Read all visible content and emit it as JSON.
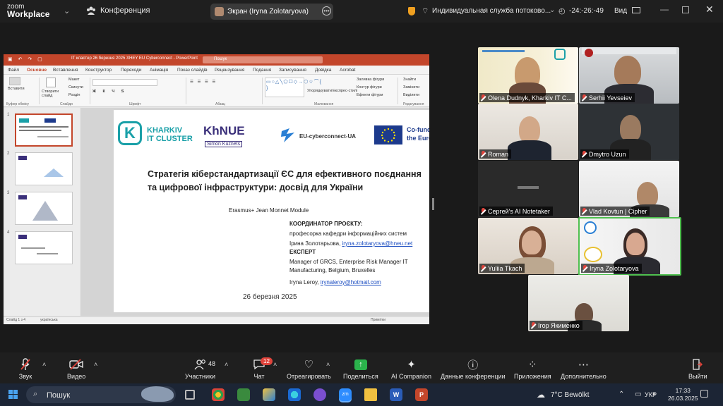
{
  "topbar": {
    "logo_line1": "zoom",
    "logo_line2": "Workplace",
    "conference": "Конференция",
    "screen_share_label": "Экран (Iryna Zolotaryova)",
    "service": "Индивидуальная служба потоково...",
    "timer": "-24:-26:-49",
    "view": "Вид"
  },
  "ppt": {
    "title": "IT кластер 26 березня 2025 XHEY EU Cyberconnect - PowerPoint",
    "search": "Пошук",
    "menu": [
      "Файл",
      "Основне",
      "Вставлення",
      "Конструктор",
      "Переходи",
      "Анімація",
      "Показ слайдів",
      "Рецензування",
      "Подання",
      "Записування",
      "Довідка",
      "Acrobat"
    ],
    "active_menu": "Основне",
    "ribbon": {
      "paste": "Вставити",
      "clipboard": "Буфер обміну",
      "new_slide": "Створити слайд",
      "layout": "Макет",
      "reset": "Скинути",
      "section": "Розділ",
      "slides": "Слайди",
      "font": "Шрифт",
      "paragraph": "Абзац",
      "arrange": "Упорядкувати",
      "quick_styles": "Експрес-стилі",
      "shape_fill": "Заливка фігури",
      "shape_outline": "Контур фігури",
      "shape_effects": "Ефекти фігури",
      "drawing": "Малювання",
      "find": "Знайти",
      "replace": "Замінити",
      "select": "Виділити",
      "editing": "Редагування"
    },
    "status": "Слайд 1 з 4",
    "language": "українська",
    "notes": "Примітки",
    "thumb_numbers": [
      "1",
      "2",
      "3",
      "4"
    ]
  },
  "slide": {
    "logo1_line1": "KHARKIV",
    "logo1_line2": "IT CLUSTER",
    "logo2": "KhNUE",
    "logo2_sub": "Simon Kuznets",
    "logo3": "EU-cyberconnect-UA",
    "logo4_line1": "Co-funded by",
    "logo4_line2": "the European Union",
    "title": "Стратегія кіберстандартизації ЄС для ефективного поєднання та цифрової інфраструктури: досвід для України",
    "module": "Erasmus+ Jean Monnet Module",
    "coordinator_heading": "КООРДИНАТОР ПРОЄКТУ:",
    "coordinator_role": "професорка кафедри інформаційних систем",
    "coordinator_name": "Ірина Золотарьова,",
    "coordinator_email": "iryna.zolotaryova@hneu.net",
    "expert_heading": "ЕКСПЕРТ",
    "expert_role1": "Manager of GRCS, Enterprise Risk Manager IT",
    "expert_role2": "Manufacturing, Belgium, Bruxelles",
    "expert_name": "Iryna Leroy,",
    "expert_email": "irynaleroy@hotmail.com",
    "date": "26 березня 2025"
  },
  "participants": [
    {
      "name": "Olena Dudnyk, Kharkiv IT C..."
    },
    {
      "name": "Serhii Yevseiev"
    },
    {
      "name": "Roman"
    },
    {
      "name": "Dmytro Uzun"
    },
    {
      "name": "Сергей's AI Notetaker"
    },
    {
      "name": "Vlad Kovtun | Cipher"
    },
    {
      "name": "Yuliia Tkach"
    },
    {
      "name": "Iryna Zolotaryova"
    },
    {
      "name": "Ігор Якименко"
    }
  ],
  "toolbar": {
    "audio": "Звук",
    "video": "Видео",
    "participants": "Участники",
    "participants_count": "48",
    "chat": "Чат",
    "chat_badge": "12",
    "react": "Отреагировать",
    "share": "Поделиться",
    "ai": "AI Companion",
    "info": "Данные конференции",
    "apps": "Приложения",
    "more": "Дополнительно",
    "leave": "Выйти"
  },
  "taskbar": {
    "search": "Пошук",
    "weather": "7°C  Bewölkt",
    "language": "УКР",
    "time": "17:33",
    "date": "26.03.2025"
  }
}
